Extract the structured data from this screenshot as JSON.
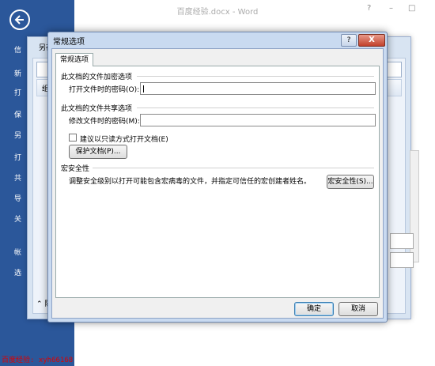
{
  "window": {
    "title": "百度经验.docx - Word",
    "controls": [
      "?",
      "–",
      "□"
    ]
  },
  "backstage": {
    "items": [
      "信",
      "新",
      "打",
      "保",
      "另",
      "打",
      "共",
      "导",
      "关",
      "帐",
      "选"
    ]
  },
  "saveas_dialog": {
    "title": "另存",
    "toolbar_label": "组织",
    "hide_folders": "隐"
  },
  "dialog": {
    "title": "常规选项",
    "help": "?",
    "close": "X",
    "tab": "常规选项",
    "encrypt_group": "此文档的文件加密选项",
    "open_password_label": "打开文件时的密码(O):",
    "open_password_value": "",
    "share_group": "此文档的文件共享选项",
    "modify_password_label": "修改文件时的密码(M):",
    "modify_password_value": "",
    "readonly_label": "建议以只读方式打开文档(E)",
    "protect_button": "保护文档(P)...",
    "macro_group": "宏安全性",
    "macro_desc": "调整安全级别以打开可能包含宏病毒的文件，并指定可信任的宏创建者姓名。",
    "macro_button": "宏安全性(S)...",
    "ok": "确定",
    "cancel": "取消"
  },
  "watermark": "百度经验: xyh66168"
}
